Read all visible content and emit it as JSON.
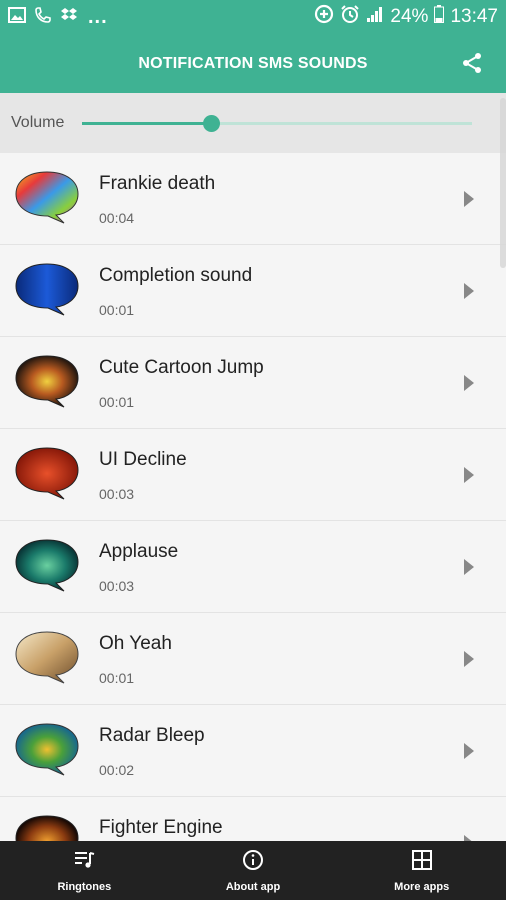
{
  "status_bar": {
    "icons_left": [
      "image-icon",
      "missed-call-icon",
      "dropbox-icon"
    ],
    "more_notifications": "...",
    "icons_right": [
      "data-saver-icon",
      "alarm-icon",
      "signal-icon"
    ],
    "battery_percent": "24%",
    "time": "13:47"
  },
  "header": {
    "title": "NOTIFICATION SMS SOUNDS",
    "share_icon": "share-icon"
  },
  "volume": {
    "label": "Volume",
    "level": 0.33
  },
  "sounds": [
    {
      "name": "Frankie death",
      "duration": "00:04"
    },
    {
      "name": "Completion sound",
      "duration": "00:01"
    },
    {
      "name": "Cute Cartoon Jump",
      "duration": "00:01"
    },
    {
      "name": "UI Decline",
      "duration": "00:03"
    },
    {
      "name": "Applause",
      "duration": "00:03"
    },
    {
      "name": "Oh Yeah",
      "duration": "00:01"
    },
    {
      "name": "Radar Bleep",
      "duration": "00:02"
    },
    {
      "name": "Fighter Engine",
      "duration": ""
    }
  ],
  "bottom_nav": {
    "ringtones": "Ringtones",
    "about": "About app",
    "more": "More apps"
  },
  "colors": {
    "primary": "#3fb293",
    "nav_bg": "#222222"
  }
}
